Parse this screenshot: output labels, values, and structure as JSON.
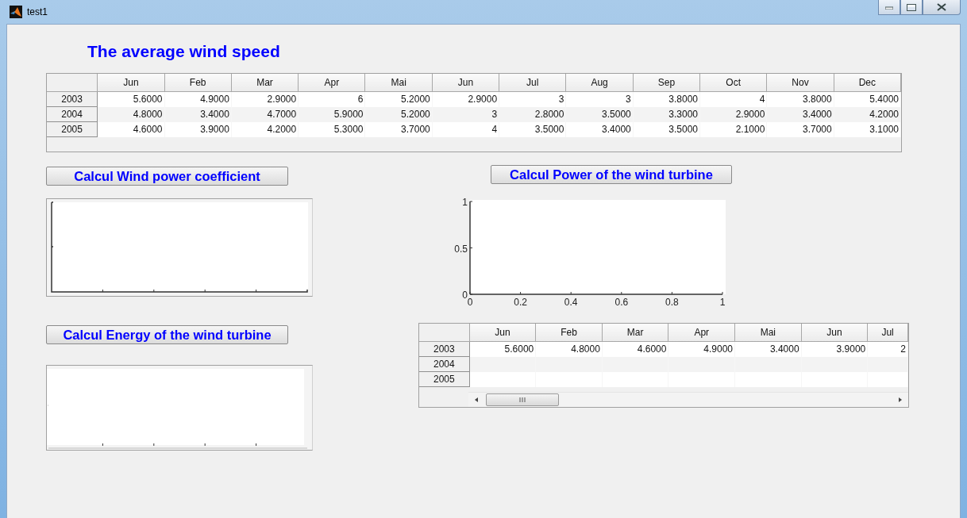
{
  "window": {
    "title": "test1"
  },
  "heading": "The average wind speed",
  "speed_table": {
    "columns": [
      "Jun",
      "Feb",
      "Mar",
      "Apr",
      "Mai",
      "Jun",
      "Jul",
      "Aug",
      "Sep",
      "Oct",
      "Nov",
      "Dec"
    ],
    "rows": [
      {
        "label": "2003",
        "cells": [
          "5.6000",
          "4.9000",
          "2.9000",
          "6",
          "5.2000",
          "2.9000",
          "3",
          "3",
          "3.8000",
          "4",
          "3.8000",
          "5.4000"
        ]
      },
      {
        "label": "2004",
        "cells": [
          "4.8000",
          "3.4000",
          "4.7000",
          "5.9000",
          "5.2000",
          "3",
          "2.8000",
          "3.5000",
          "3.3000",
          "2.9000",
          "3.4000",
          "4.2000"
        ]
      },
      {
        "label": "2005",
        "cells": [
          "4.6000",
          "3.9000",
          "4.2000",
          "5.3000",
          "3.7000",
          "4",
          "3.5000",
          "3.4000",
          "3.5000",
          "2.1000",
          "3.7000",
          "3.1000"
        ]
      }
    ]
  },
  "coefficient_button": "Calcul Wind power coefficient",
  "energy_button": "Calcul Energy of the wind turbine",
  "power_button": "Calcul Power of the wind turbine",
  "power_axes": {
    "chart_data": {
      "type": "line",
      "xlim": [
        0,
        1
      ],
      "ylim": [
        0,
        1
      ],
      "xticks": [
        {
          "value": 0,
          "label": "0"
        },
        {
          "value": 0.2,
          "label": "0.2"
        },
        {
          "value": 0.4,
          "label": "0.4"
        },
        {
          "value": 0.6,
          "label": "0.6"
        },
        {
          "value": 0.8,
          "label": "0.8"
        },
        {
          "value": 1,
          "label": "1"
        }
      ],
      "yticks": [
        {
          "value": 0,
          "label": "0"
        },
        {
          "value": 0.5,
          "label": "0.5"
        },
        {
          "value": 1,
          "label": "1"
        }
      ]
    }
  },
  "result_table": {
    "columns": [
      "Jun",
      "Feb",
      "Mar",
      "Apr",
      "Mai",
      "Jun",
      "Jul"
    ],
    "rows": [
      {
        "label": "2003",
        "cells": [
          "5.6000",
          "4.8000",
          "4.6000",
          "4.9000",
          "3.4000",
          "3.9000",
          "2"
        ]
      },
      {
        "label": "2004"
      },
      {
        "label": "2005"
      }
    ]
  }
}
